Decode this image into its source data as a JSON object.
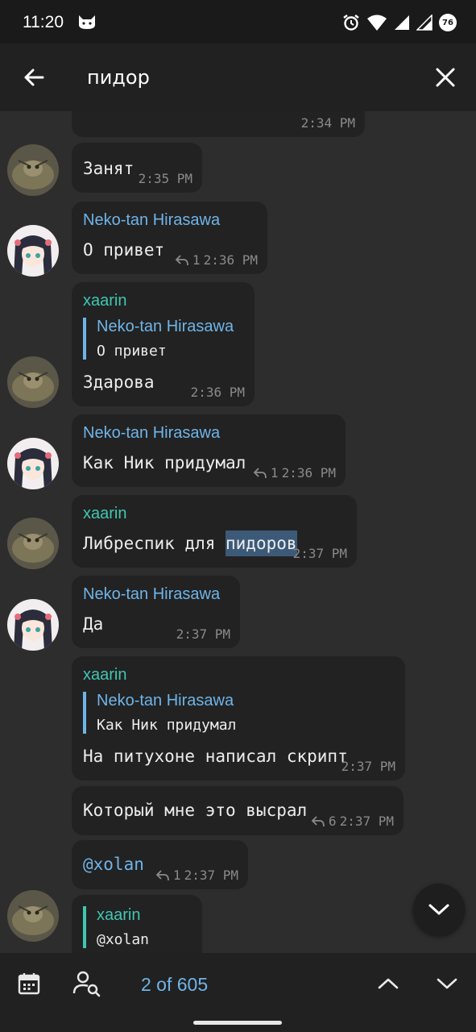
{
  "status": {
    "time": "11:20",
    "battery": "76",
    "icons": [
      "cat-icon",
      "alarm-icon",
      "wifi-icon",
      "signal-icon",
      "signal-icon",
      "battery-icon"
    ]
  },
  "search": {
    "query": "пидор",
    "back_icon": "arrow-left-icon",
    "close_icon": "close-icon"
  },
  "messages": [
    {
      "time": "2:34 PM"
    },
    {
      "text": "Занят",
      "time": "2:35 PM"
    },
    {
      "sender": "Neko-tan Hirasawa",
      "text": "О привет",
      "replies": "1",
      "time": "2:36 PM"
    },
    {
      "sender": "xaarin",
      "reply_to": {
        "name": "Neko-tan Hirasawa",
        "text": "О привет"
      },
      "text": "Здарова",
      "time": "2:36 PM"
    },
    {
      "sender": "Neko-tan Hirasawa",
      "text": "Как Ник придумал",
      "replies": "1",
      "time": "2:36 PM"
    },
    {
      "sender": "xaarin",
      "text_before": "Либреспик для ",
      "text_highlight": "пидоров",
      "time": "2:37 PM"
    },
    {
      "sender": "Neko-tan Hirasawa",
      "text": "Да",
      "time": "2:37 PM"
    },
    {
      "sender": "xaarin",
      "reply_to": {
        "name": "Neko-tan Hirasawa",
        "text": "Как Ник придумал"
      },
      "text": "На питухоне написал скрипт",
      "time": "2:37 PM"
    },
    {
      "text": "Который мне это высрал",
      "replies": "6",
      "time": "2:37 PM"
    },
    {
      "text": "@xolan",
      "replies": "1",
      "time": "2:37 PM"
    },
    {
      "reply_to": {
        "name": "xaarin",
        "text": "@xolan"
      }
    }
  ],
  "bottom": {
    "counter": "2 of 605",
    "icons": [
      "calendar-icon",
      "search-user-icon",
      "chevron-up-icon",
      "chevron-down-icon"
    ]
  },
  "colors": {
    "accent_blue": "#6fb4e8",
    "accent_teal": "#3fc7b2",
    "bubble": "#222222",
    "background": "#2d2d2d",
    "highlight": "#3c5a78"
  }
}
